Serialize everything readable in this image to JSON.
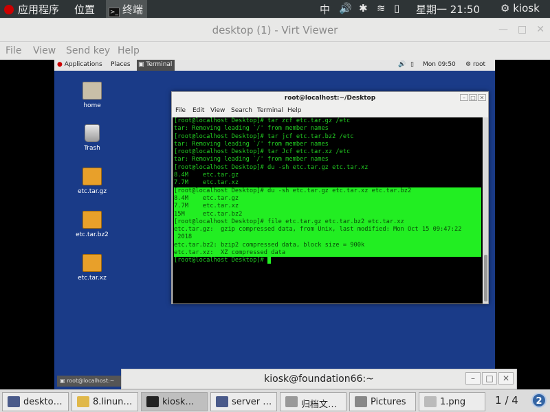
{
  "host_topbar": {
    "apps_label": "应用程序",
    "places_label": "位置",
    "terminal_task": "终端",
    "ime": "中",
    "clock": "星期一 21:50",
    "user": "kiosk"
  },
  "viewer": {
    "title": "desktop (1) - Virt Viewer",
    "menu": [
      "File",
      "View",
      "Send key",
      "Help"
    ]
  },
  "vm_topbar": {
    "apps": "Applications",
    "places": "Places",
    "terminal_task": "Terminal",
    "clock": "Mon 09:50",
    "user": "root"
  },
  "desktop_icons": [
    {
      "label": "home",
      "icon": "folder-home-icon"
    },
    {
      "label": "Trash",
      "icon": "trash-icon"
    },
    {
      "label": "etc.tar.gz",
      "icon": "archive-icon"
    },
    {
      "label": "etc.tar.bz2",
      "icon": "archive-icon"
    },
    {
      "label": "etc.tar.xz",
      "icon": "archive-icon"
    }
  ],
  "terminal": {
    "title": "root@localhost:~/Desktop",
    "menu": [
      "File",
      "Edit",
      "View",
      "Search",
      "Terminal",
      "Help"
    ],
    "lines": [
      "[root@localhost Desktop]# tar zcf etc.tar.gz /etc",
      "tar: Removing leading `/' from member names",
      "[root@localhost Desktop]# tar jcf etc.tar.bz2 /etc",
      "tar: Removing leading `/' from member names",
      "[root@localhost Desktop]# tar Jcf etc.tar.xz /etc",
      "tar: Removing leading `/' from member names",
      "[root@localhost Desktop]# du -sh etc.tar.gz etc.tar.xz",
      "8.4M    etc.tar.gz",
      "7.7M    etc.tar.xz",
      "[root@localhost Desktop]# du -sh etc.tar.gz etc.tar.xz etc.tar.bz2",
      "8.4M    etc.tar.gz",
      "7.7M    etc.tar.xz",
      "15M     etc.tar.bz2",
      "[root@localhost Desktop]# file etc.tar.gz etc.tar.bz2 etc.tar.xz",
      "etc.tar.gz:  gzip compressed data, from Unix, last modified: Mon Oct 15 09:47:22",
      " 2018",
      "etc.tar.bz2: bzip2 compressed data, block size = 900k",
      "etc.tar.xz:  XZ compressed data",
      "[root@localhost Desktop]# "
    ]
  },
  "vm_bottom_task": "root@localhost:~",
  "kiosk_window_title": "kiosk@foundation66:~",
  "host_taskbar": {
    "tasks": [
      "deskto…",
      "8.linun…",
      "kiosk…",
      "server …",
      "归档文…",
      "Pictures",
      "1.png"
    ],
    "pager": "1 / 4"
  },
  "colors": {
    "highlight": "#22ee22",
    "terminal_text": "#22cc22",
    "vm_desktop": "#1a3b88"
  }
}
